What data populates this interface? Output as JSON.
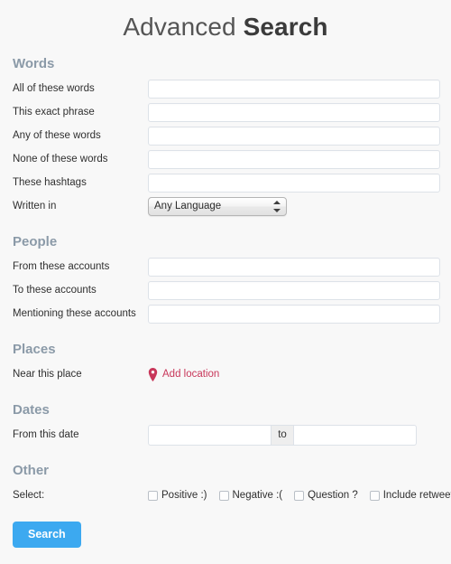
{
  "page": {
    "title_thin": "Advanced",
    "title_bold": "Search"
  },
  "sections": {
    "words": {
      "heading": "Words",
      "fields": {
        "all_words": {
          "label": "All of these words",
          "value": "",
          "placeholder": ""
        },
        "exact_phrase": {
          "label": "This exact phrase",
          "value": "",
          "placeholder": ""
        },
        "any_words": {
          "label": "Any of these words",
          "value": "",
          "placeholder": ""
        },
        "none_words": {
          "label": "None of these words",
          "value": "",
          "placeholder": ""
        },
        "hashtags": {
          "label": "These hashtags",
          "value": "",
          "placeholder": ""
        },
        "written_in": {
          "label": "Written in",
          "selected": "Any Language"
        }
      }
    },
    "people": {
      "heading": "People",
      "fields": {
        "from_accounts": {
          "label": "From these accounts",
          "value": "",
          "placeholder": ""
        },
        "to_accounts": {
          "label": "To these accounts",
          "value": "",
          "placeholder": ""
        },
        "mentioning_accounts": {
          "label": "Mentioning these accounts",
          "value": "",
          "placeholder": ""
        }
      }
    },
    "places": {
      "heading": "Places",
      "fields": {
        "near_place": {
          "label": "Near this place",
          "link_label": "Add location",
          "icon": "map-pin-icon",
          "link_color": "#c8375a"
        }
      }
    },
    "dates": {
      "heading": "Dates",
      "fields": {
        "from_date": {
          "label": "From this date",
          "start_value": "",
          "start_placeholder": "",
          "separator": "to",
          "end_value": "",
          "end_placeholder": ""
        }
      }
    },
    "other": {
      "heading": "Other",
      "select_label": "Select:",
      "checkboxes": [
        {
          "label": "Positive :)",
          "checked": false
        },
        {
          "label": "Negative :(",
          "checked": false
        },
        {
          "label": "Question ?",
          "checked": false
        },
        {
          "label": "Include retweets",
          "checked": false
        }
      ]
    }
  },
  "actions": {
    "search_button": "Search"
  },
  "theme": {
    "background": "#f8f8f8",
    "heading_color": "#8b9aa8",
    "accent_blue": "#3ca9f0",
    "accent_pink": "#c8375a",
    "input_border": "#dde2e8"
  }
}
